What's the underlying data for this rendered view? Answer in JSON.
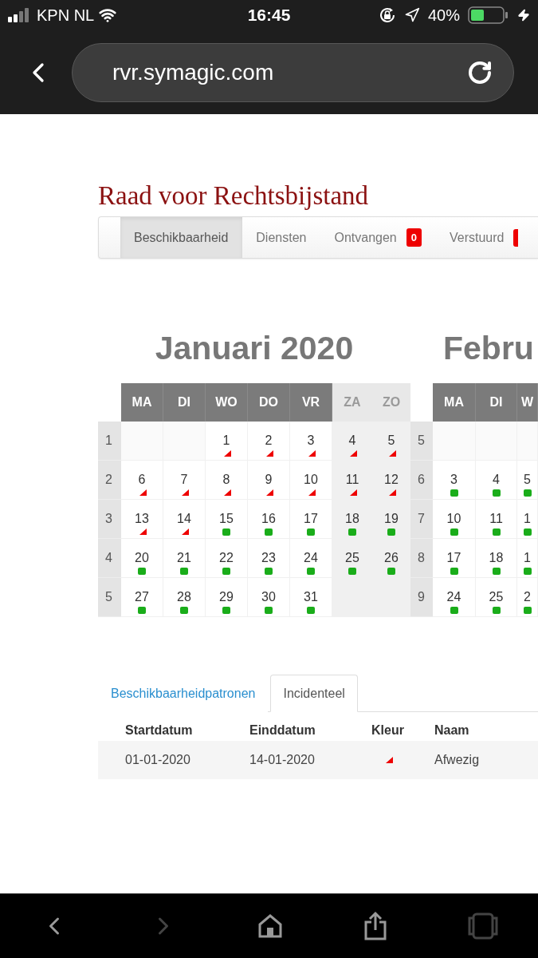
{
  "status_bar": {
    "carrier": "KPN NL",
    "time": "16:45",
    "battery": "40%"
  },
  "browser": {
    "url": "rvr.symagic.com"
  },
  "site_title": "Raad voor Rechtsbijstand",
  "nav_tabs": [
    {
      "label": "Beschikbaarheid",
      "selected": true
    },
    {
      "label": "Diensten",
      "selected": false
    },
    {
      "label": "Ontvangen",
      "selected": false,
      "badge": "0"
    },
    {
      "label": "Verstuurd",
      "selected": false,
      "has_badge": true
    }
  ],
  "calendars": [
    {
      "title": "Januari 2020",
      "weekdays": [
        {
          "label": "MA",
          "weekend": false
        },
        {
          "label": "DI",
          "weekend": false
        },
        {
          "label": "WO",
          "weekend": false
        },
        {
          "label": "DO",
          "weekend": false
        },
        {
          "label": "VR",
          "weekend": false
        },
        {
          "label": "ZA",
          "weekend": true
        },
        {
          "label": "ZO",
          "weekend": true
        }
      ],
      "weeks": [
        {
          "number": "1",
          "days": [
            {
              "kind": "blank"
            },
            {
              "kind": "blank"
            },
            {
              "day": "1",
              "kind": "absent"
            },
            {
              "day": "2",
              "kind": "absent"
            },
            {
              "day": "3",
              "kind": "absent"
            },
            {
              "day": "4",
              "kind": "absent"
            },
            {
              "day": "5",
              "kind": "absent"
            }
          ]
        },
        {
          "number": "2",
          "days": [
            {
              "day": "6",
              "kind": "absent"
            },
            {
              "day": "7",
              "kind": "absent"
            },
            {
              "day": "8",
              "kind": "absent"
            },
            {
              "day": "9",
              "kind": "absent"
            },
            {
              "day": "10",
              "kind": "absent"
            },
            {
              "day": "11",
              "kind": "absent"
            },
            {
              "day": "12",
              "kind": "absent"
            }
          ]
        },
        {
          "number": "3",
          "days": [
            {
              "day": "13",
              "kind": "absent"
            },
            {
              "day": "14",
              "kind": "absent"
            },
            {
              "day": "15",
              "kind": "available"
            },
            {
              "day": "16",
              "kind": "available"
            },
            {
              "day": "17",
              "kind": "available"
            },
            {
              "day": "18",
              "kind": "available"
            },
            {
              "day": "19",
              "kind": "available"
            }
          ]
        },
        {
          "number": "4",
          "days": [
            {
              "day": "20",
              "kind": "available"
            },
            {
              "day": "21",
              "kind": "available"
            },
            {
              "day": "22",
              "kind": "available"
            },
            {
              "day": "23",
              "kind": "available"
            },
            {
              "day": "24",
              "kind": "available"
            },
            {
              "day": "25",
              "kind": "available"
            },
            {
              "day": "26",
              "kind": "available"
            }
          ]
        },
        {
          "number": "5",
          "days": [
            {
              "day": "27",
              "kind": "available"
            },
            {
              "day": "28",
              "kind": "available"
            },
            {
              "day": "29",
              "kind": "available"
            },
            {
              "day": "30",
              "kind": "available"
            },
            {
              "day": "31",
              "kind": "available"
            },
            {
              "kind": "blank"
            },
            {
              "kind": "blank"
            }
          ]
        }
      ]
    },
    {
      "title": "Febru",
      "weekdays": [
        {
          "label": "MA",
          "weekend": false
        },
        {
          "label": "DI",
          "weekend": false
        },
        {
          "label": "W",
          "weekend": false
        }
      ],
      "weeks": [
        {
          "number": "5",
          "days": [
            {
              "kind": "blank"
            },
            {
              "kind": "blank"
            },
            {
              "kind": "blank"
            }
          ]
        },
        {
          "number": "6",
          "days": [
            {
              "day": "3",
              "kind": "available"
            },
            {
              "day": "4",
              "kind": "available"
            },
            {
              "day": "5",
              "kind": "available"
            }
          ]
        },
        {
          "number": "7",
          "days": [
            {
              "day": "10",
              "kind": "available"
            },
            {
              "day": "11",
              "kind": "available"
            },
            {
              "day": "1",
              "kind": "available"
            }
          ]
        },
        {
          "number": "8",
          "days": [
            {
              "day": "17",
              "kind": "available"
            },
            {
              "day": "18",
              "kind": "available"
            },
            {
              "day": "1",
              "kind": "available"
            }
          ]
        },
        {
          "number": "9",
          "days": [
            {
              "day": "24",
              "kind": "available"
            },
            {
              "day": "25",
              "kind": "available"
            },
            {
              "day": "2",
              "kind": "available"
            }
          ]
        }
      ]
    }
  ],
  "lower_tabs": [
    {
      "label": "Beschikbaarheidpatronen",
      "selected": false
    },
    {
      "label": "Incidenteel",
      "selected": true
    }
  ],
  "table": {
    "columns": [
      "Startdatum",
      "Einddatum",
      "Kleur",
      "Naam"
    ],
    "rows": [
      {
        "start": "01-01-2020",
        "end": "14-01-2020",
        "kind": "absent",
        "name": "Afwezig"
      }
    ]
  }
}
